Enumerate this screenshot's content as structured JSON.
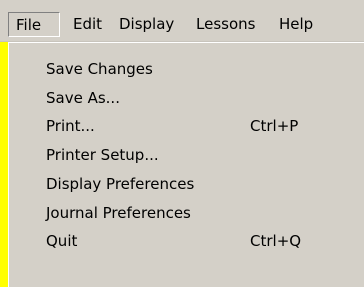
{
  "menubar": {
    "items": [
      {
        "label": "File"
      },
      {
        "label": "Edit"
      },
      {
        "label": "Display"
      },
      {
        "label": "Lessons"
      },
      {
        "label": "Help"
      }
    ]
  },
  "file_menu": {
    "items": [
      {
        "label": "Save Changes",
        "shortcut": ""
      },
      {
        "label": "Save As...",
        "shortcut": ""
      },
      {
        "label": "Print...",
        "shortcut": "Ctrl+P"
      },
      {
        "label": "Printer Setup...",
        "shortcut": ""
      },
      {
        "label": "Display Preferences",
        "shortcut": ""
      },
      {
        "label": "Journal Preferences",
        "shortcut": ""
      },
      {
        "label": "Quit",
        "shortcut": "Ctrl+Q"
      }
    ]
  },
  "colors": {
    "background": "#ffff00",
    "menu_face": "#d4d0c8"
  }
}
